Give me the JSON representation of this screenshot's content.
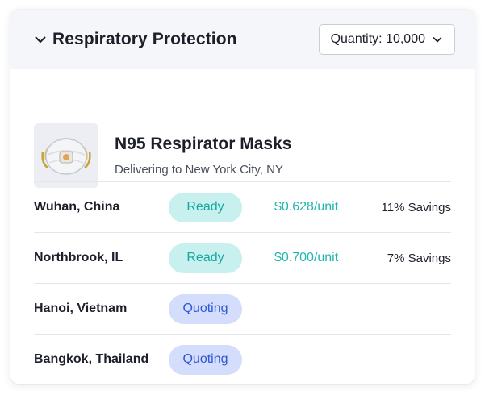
{
  "header": {
    "title": "Respiratory Protection",
    "quantity_label": "Quantity: 10,000"
  },
  "product": {
    "name": "N95 Respirator Masks",
    "delivery": "Delivering to New York City, NY"
  },
  "suppliers": [
    {
      "location": "Wuhan, China",
      "status": "Ready",
      "price": "$0.628/unit",
      "savings": "11% Savings"
    },
    {
      "location": "Northbrook, IL",
      "status": "Ready",
      "price": "$0.700/unit",
      "savings": "7% Savings"
    },
    {
      "location": "Hanoi, Vietnam",
      "status": "Quoting",
      "price": "",
      "savings": ""
    },
    {
      "location": "Bangkok, Thailand",
      "status": "Quoting",
      "price": "",
      "savings": ""
    }
  ],
  "colors": {
    "ready_bg": "#c8f0ee",
    "ready_text": "#14a8a0",
    "quoting_bg": "#d4ddfb",
    "quoting_text": "#2f56d6",
    "price_text": "#1fb6ad"
  }
}
